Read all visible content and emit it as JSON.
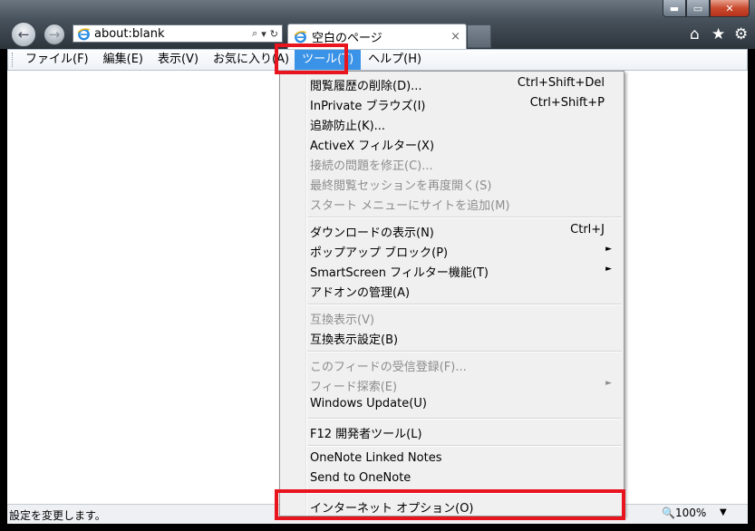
{
  "window": {
    "caption_buttons": {
      "minimize": "▬",
      "maximize": "▭",
      "close": "✕"
    }
  },
  "navigation": {
    "back_glyph": "←",
    "forward_glyph": "→",
    "address": "about:blank",
    "address_tools": {
      "search": "⌕",
      "dropdown": "▾",
      "refresh": "↻"
    }
  },
  "tabs": [
    {
      "title": "空白のページ",
      "close": "×"
    }
  ],
  "toolbar_icons": {
    "home": "⌂",
    "favorites": "★",
    "tools": "⚙"
  },
  "menubar": {
    "items": [
      "ファイル(F)",
      "編集(E)",
      "表示(V)",
      "お気に入り(A)",
      "ツール(T)",
      "ヘルプ(H)"
    ]
  },
  "tools_menu": {
    "items": [
      {
        "label": "閲覧履歴の削除(D)...",
        "shortcut": "Ctrl+Shift+Del",
        "disabled": false
      },
      {
        "label": "InPrivate ブラウズ(I)",
        "shortcut": "Ctrl+Shift+P",
        "disabled": false
      },
      {
        "label": "追跡防止(K)...",
        "shortcut": "",
        "disabled": false
      },
      {
        "label": "ActiveX フィルター(X)",
        "shortcut": "",
        "disabled": false
      },
      {
        "label": "接続の問題を修正(C)...",
        "shortcut": "",
        "disabled": true
      },
      {
        "label": "最終閲覧セッションを再度開く(S)",
        "shortcut": "",
        "disabled": true
      },
      {
        "label": "スタート メニューにサイトを追加(M)",
        "shortcut": "",
        "disabled": true
      },
      {
        "label": "ダウンロードの表示(N)",
        "shortcut": "Ctrl+J",
        "disabled": false
      },
      {
        "label": "ポップアップ ブロック(P)",
        "shortcut": "",
        "disabled": false,
        "submenu": "►"
      },
      {
        "label": "SmartScreen フィルター機能(T)",
        "shortcut": "",
        "disabled": false,
        "submenu": "►"
      },
      {
        "label": "アドオンの管理(A)",
        "shortcut": "",
        "disabled": false
      },
      {
        "label": "互換表示(V)",
        "shortcut": "",
        "disabled": true
      },
      {
        "label": "互換表示設定(B)",
        "shortcut": "",
        "disabled": false
      },
      {
        "label": "このフィードの受信登録(F)...",
        "shortcut": "",
        "disabled": true
      },
      {
        "label": "フィード探索(E)",
        "shortcut": "",
        "disabled": true,
        "submenu": "►"
      },
      {
        "label": "Windows Update(U)",
        "shortcut": "",
        "disabled": false
      },
      {
        "label": "F12 開発者ツール(L)",
        "shortcut": "",
        "disabled": false
      },
      {
        "label": "OneNote Linked Notes",
        "shortcut": "",
        "disabled": false
      },
      {
        "label": "Send to OneNote",
        "shortcut": "",
        "disabled": false
      },
      {
        "label": "インターネット オプション(O)",
        "shortcut": "",
        "disabled": false
      }
    ]
  },
  "statusbar": {
    "text": "設定を変更します。",
    "zoom": "100%",
    "zoom_dropdown": "▼"
  },
  "colors": {
    "highlight_box": "#e8141e",
    "menu_active": "#3b93e8",
    "disabled_text": "#8d8d8d"
  }
}
